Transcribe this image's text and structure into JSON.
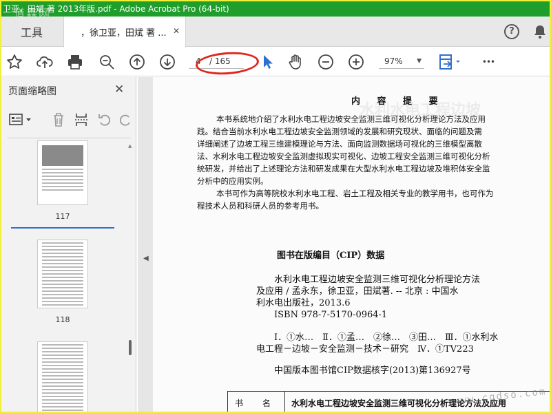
{
  "window": {
    "title": "卫亚，田斌 著 2013年版.pdf - Adobe Acrobat Pro (64-bit)",
    "watermark": "道森网"
  },
  "tabs": {
    "tools_label": "工具",
    "doc_label": "，徐卫亚，田斌 著 ...",
    "close_symbol": "✕"
  },
  "header": {
    "help_symbol": "?"
  },
  "toolbar": {
    "current_page": "4",
    "page_total": "/ 165",
    "zoom": "97%",
    "zoom_caret": "▼",
    "more_symbol": "•••",
    "icons": [
      "star-icon",
      "upload-icon",
      "print-icon",
      "zoom-out-search-icon",
      "page-up-icon",
      "page-down-icon",
      "select-cursor-icon",
      "hand-icon",
      "zoom-out-icon",
      "zoom-in-icon",
      "page-fit-icon",
      "more-icon"
    ],
    "accent_color": "#2f6fcf",
    "annotation_color": "#e0261c"
  },
  "sidebar": {
    "title": "页面缩略图",
    "close_symbol": "✕",
    "thumbnails": [
      {
        "page_label": "117"
      },
      {
        "page_label": "118"
      }
    ]
  },
  "page": {
    "heading": "内 容 提 要",
    "summary_lines": [
      "本书系统地介绍了水利水电工程边坡安全监测三维可视化分析理论方法及应用",
      "践。结合当前水利水电工程边坡安全监测领域的发展和研究现状、面临的问题及需",
      "详细阐述了边坡工程三维建模理论与方法、面向监测数据场可视化的三维模型离散",
      "法、水利水电工程边坡安全监测虚拟现实可视化、边坡工程安全监测三维可视化分析",
      "统研发，并给出了上述理论方法和研发成果在大型水利水电工程边坡及堆积体安全监",
      "分析中的应用实例。",
      "本书可作为高等院校水利水电工程、岩土工程及相关专业的教学用书，也可作为",
      "程技术人员和科研人员的参考用书。"
    ],
    "cip_title": "图书在版编目（CIP）数据",
    "cip_lines": [
      "水利水电工程边坡安全监测三维可视化分析理论方法",
      "及应用 / 孟永东，徐卫亚，田斌著. -- 北京 : 中国水",
      "利水电出版社，2013.6",
      "ISBN 978-7-5170-0964-1",
      "Ⅰ．①水…　Ⅱ．①孟…　②徐…　③田…　Ⅲ．①水利水",
      "电工程－边坡－安全监测－技术－研究　Ⅳ．①TV223",
      "中国版本图书馆CIP数据核字(2013)第136927号"
    ],
    "table_label": "书名",
    "table_value": "水利水电工程边坡安全监测三维可视化分析理论方法及应用",
    "site_watermark": "www.cgdso.com"
  }
}
